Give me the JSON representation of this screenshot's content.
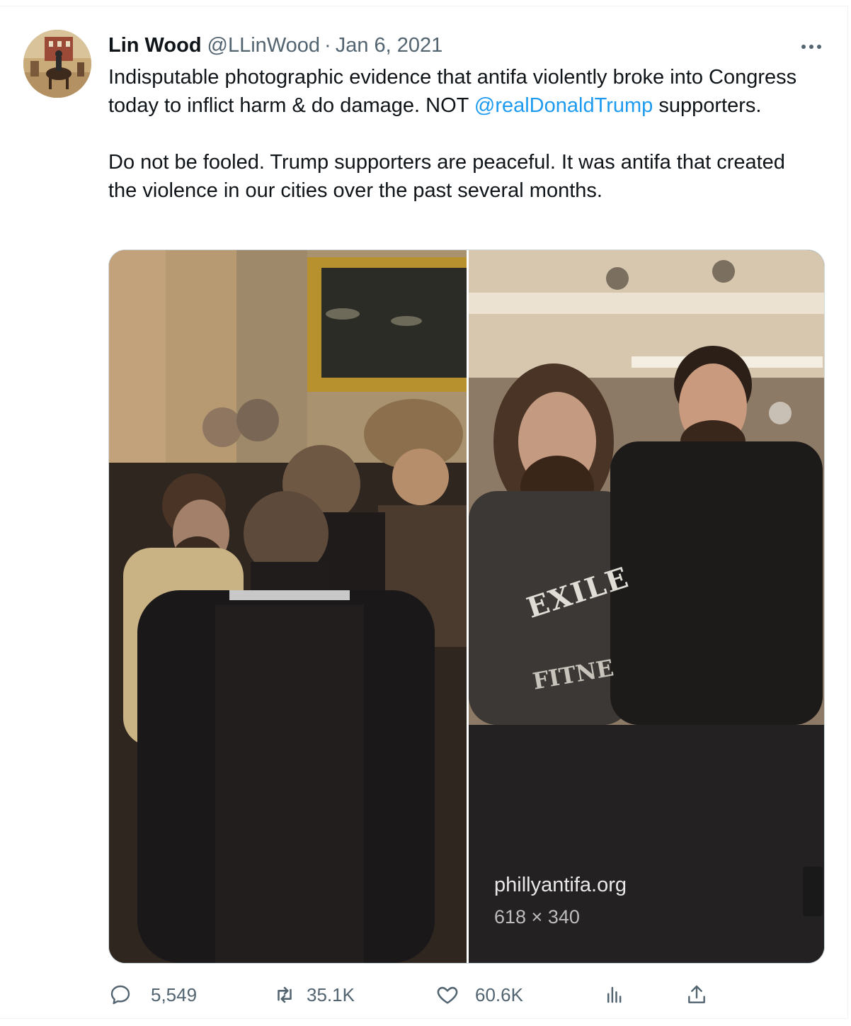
{
  "tweet": {
    "author": {
      "display_name": "Lin Wood",
      "handle": "@LLinWood",
      "avatar_icon": "avatar-horseman"
    },
    "separator": "·",
    "date": "Jan 6, 2021",
    "more_icon": "more-horizontal-icon",
    "text": {
      "line1_pre": "Indisputable photographic evidence that antifa violently broke into Congress today to inflict harm & do damage. NOT ",
      "mention": "@realDonaldTrump",
      "line1_post": " supporters.",
      "paragraph2": "Do not be fooled. Trump supporters are peaceful. It was antifa that created the violence in our cities over the past several months."
    },
    "media": {
      "source_caption": "phillyantifa.org",
      "dimensions_caption": "618 × 340",
      "shirt_text_1": "EXILE",
      "shirt_text_2": "FITNE"
    },
    "actions": {
      "reply": {
        "icon": "reply-icon",
        "count": "5,549"
      },
      "retweet": {
        "icon": "retweet-icon",
        "count": "35.1K"
      },
      "like": {
        "icon": "heart-icon",
        "count": "60.6K"
      },
      "views": {
        "icon": "analytics-icon"
      },
      "share": {
        "icon": "share-icon"
      }
    }
  },
  "colors": {
    "text_primary": "#0f1419",
    "text_secondary": "#536471",
    "link": "#1d9bf0",
    "border": "#cfd9de"
  }
}
